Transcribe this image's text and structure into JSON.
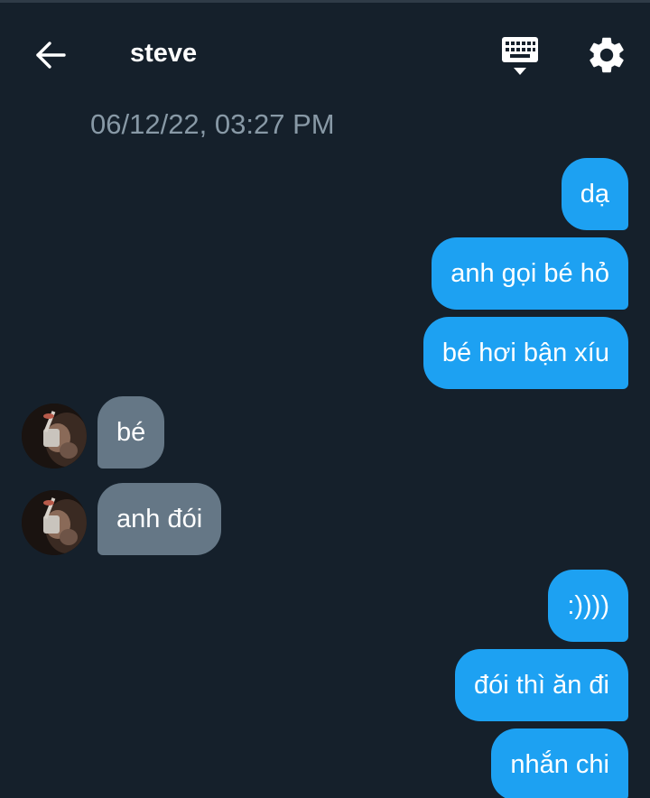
{
  "header": {
    "title": "steve",
    "back_icon": "arrow-left-icon",
    "keyboard_icon": "keyboard-icon",
    "settings_icon": "gear-icon"
  },
  "conversation": {
    "timestamp": "06/12/22, 03:27 PM",
    "messages": [
      {
        "direction": "outgoing",
        "text": "dạ"
      },
      {
        "direction": "outgoing",
        "text": "anh gọi bé hỏ"
      },
      {
        "direction": "outgoing",
        "text": "bé hơi bận xíu"
      },
      {
        "direction": "incoming",
        "text": "bé"
      },
      {
        "direction": "incoming",
        "text": "anh đói"
      },
      {
        "direction": "outgoing",
        "text": ":))))"
      },
      {
        "direction": "outgoing",
        "text": "đói thì ăn đi"
      },
      {
        "direction": "outgoing",
        "text": "nhắn chi"
      }
    ]
  },
  "colors": {
    "background": "#15202b",
    "outgoing_bubble": "#1da1f2",
    "incoming_bubble": "#657786",
    "timestamp_text": "#8899a6"
  }
}
